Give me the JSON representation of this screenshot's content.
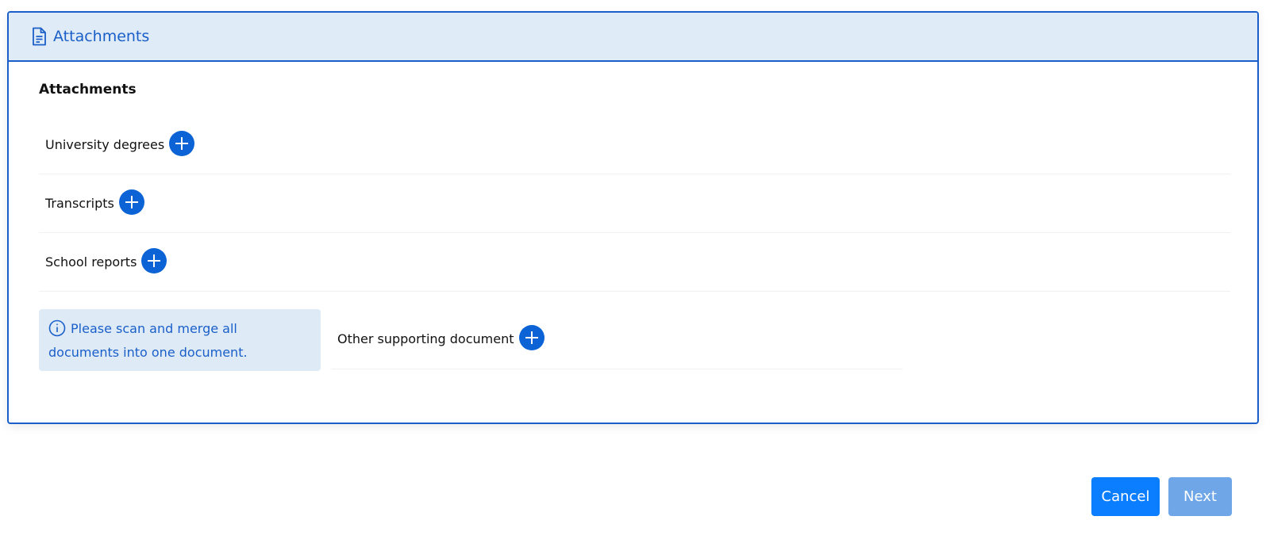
{
  "panel": {
    "header_title": "Attachments",
    "header_icon": "document-icon",
    "section_title": "Attachments",
    "rows": [
      {
        "label": "University degrees",
        "action_icon": "plus-circle-icon"
      },
      {
        "label": "Transcripts",
        "action_icon": "plus-circle-icon"
      },
      {
        "label": "School reports",
        "action_icon": "plus-circle-icon"
      }
    ],
    "info": {
      "icon": "info-icon",
      "text": "Please scan and merge all documents into one document."
    },
    "other": {
      "label": "Other supporting document",
      "action_icon": "plus-circle-icon"
    }
  },
  "footer": {
    "cancel_label": "Cancel",
    "next_label": "Next"
  },
  "colors": {
    "accent": "#1a5fc9",
    "header_bg": "#dfebf7",
    "plus_button": "#0b63d6",
    "cancel_button": "#0b7dff",
    "next_button_disabled": "#6ea6e8"
  }
}
